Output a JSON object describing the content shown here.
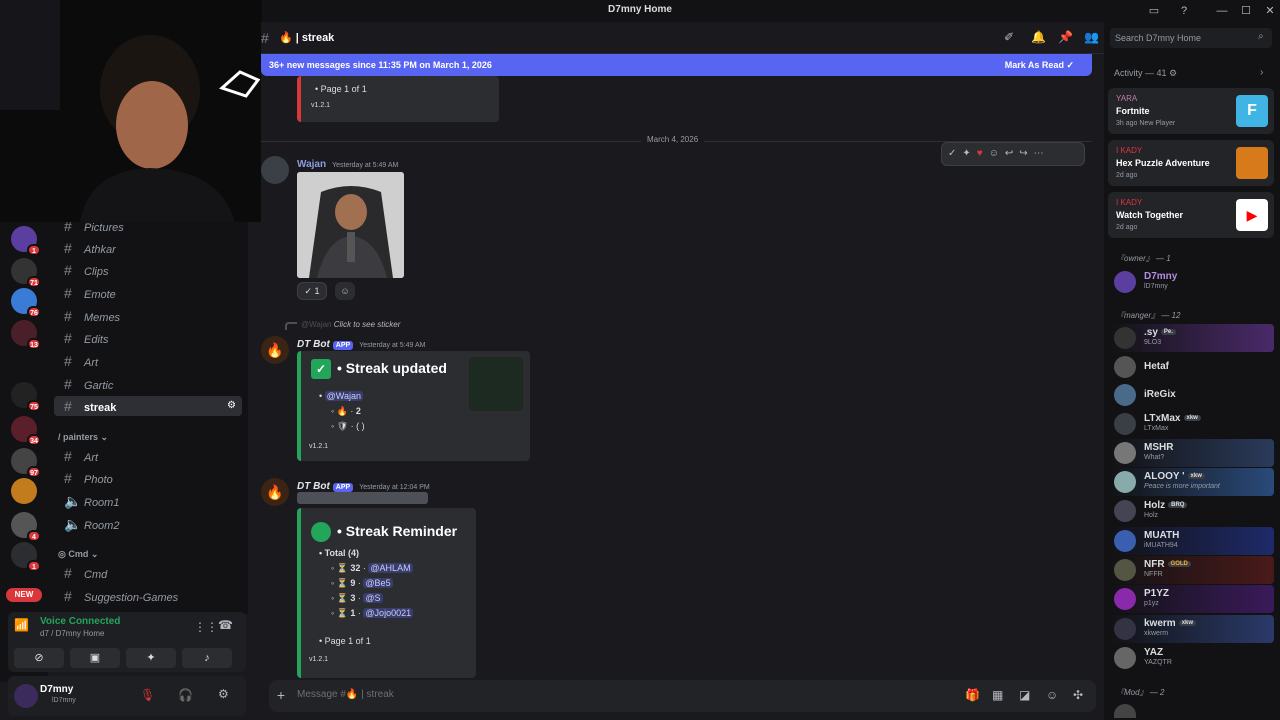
{
  "window": {
    "title": "D7mny Home"
  },
  "webcam_caption": "live streamer webcam",
  "servers": [
    {
      "badge": "1"
    },
    {
      "badge": "71"
    },
    {
      "badge": "76"
    },
    {
      "badge": "13"
    },
    {
      "badge": "75"
    },
    {
      "badge": "34"
    },
    {
      "badge": "97"
    },
    {
      "badge": ""
    },
    {
      "badge": "4"
    },
    {
      "badge": "1"
    }
  ],
  "new_badge": "NEW",
  "channels": {
    "items": [
      {
        "name": "Pictures"
      },
      {
        "name": "Athkar"
      },
      {
        "name": "Clips"
      },
      {
        "name": "Emote"
      },
      {
        "name": "Memes"
      },
      {
        "name": "Edits"
      },
      {
        "name": "Art"
      },
      {
        "name": "Gartic"
      },
      {
        "name": "streak"
      }
    ],
    "cat_painters": "painters",
    "painters_items": [
      {
        "name": "Art"
      },
      {
        "name": "Photo"
      },
      {
        "name": "Room1"
      },
      {
        "name": "Room2"
      }
    ],
    "cat_cmd": "Cmd",
    "cmd_items": [
      {
        "name": "Cmd"
      },
      {
        "name": "Suggestion-Games"
      }
    ]
  },
  "voice": {
    "status": "Voice Connected",
    "detail": "d7 / D7mny Home"
  },
  "user": {
    "name": "D7mny",
    "handle": "lD7mny"
  },
  "header": {
    "channel": "🔥 | streak",
    "search_placeholder": "Search D7mny Home"
  },
  "banner": {
    "text": "36+ new messages since 11:35 PM on March 1, 2026",
    "action": "Mark As Read"
  },
  "top_embed": {
    "page": "Page 1 of 1",
    "version": "v1.2.1"
  },
  "date_divider": "March 4, 2026",
  "msg1": {
    "author": "Wajan",
    "time": "Yesterday at 5:49 AM",
    "reaction_count": "1"
  },
  "reply": {
    "author": "@Wajan",
    "text": "Click to see sticker"
  },
  "msg2": {
    "author": "DT Bot",
    "app": "APP",
    "time": "Yesterday at 5:49 AM",
    "title": "Streak updated",
    "mention": "@Wajan",
    "line1": "2",
    "line2": "( )",
    "version": "v1.2.1"
  },
  "msg3": {
    "author": "DT Bot",
    "app": "APP",
    "time": "Yesterday at 12:04 PM",
    "title": "Streak Reminder",
    "total": "Total (4)",
    "rows": [
      {
        "n": "32",
        "u": "@AHLAM"
      },
      {
        "n": "9",
        "u": "@Be5"
      },
      {
        "n": "3",
        "u": "@S"
      },
      {
        "n": "1",
        "u": "@Jojo0021"
      }
    ],
    "page": "Page 1 of 1",
    "version": "v1.2.1"
  },
  "composer": {
    "placeholder": "Message #🔥 | streak"
  },
  "activity": {
    "header": "Activity — 41",
    "cards": [
      {
        "user": "YARA",
        "game": "Fortnite",
        "meta": "3h ago",
        "extra": "New Player"
      },
      {
        "user": "I KADY",
        "game": "Hex Puzzle Adventure",
        "meta": "2d ago",
        "extra": ""
      },
      {
        "user": "I KADY",
        "game": "Watch Together",
        "meta": "2d ago",
        "extra": ""
      }
    ]
  },
  "members": {
    "owner_header": "『owner』 — 1",
    "owner": [
      {
        "name": "D7mny",
        "status": "lD7mny"
      }
    ],
    "manger_header": "『manger』 — 12",
    "manger": [
      {
        "name": ".sy",
        "tag": "Pe.",
        "status": "9LO3"
      },
      {
        "name": "Hetaf",
        "tag": "",
        "status": ""
      },
      {
        "name": "iReGix",
        "tag": "",
        "status": ""
      },
      {
        "name": "LTxMax",
        "tag": "xkw",
        "status": "LTxMax"
      },
      {
        "name": "MSHR",
        "tag": "",
        "status": "What?"
      },
      {
        "name": "ALOOY '",
        "tag": "xkw",
        "status": "Peace is more important"
      },
      {
        "name": "Holz",
        "tag": "BRQ",
        "status": "Holz"
      },
      {
        "name": "MUATH",
        "tag": "",
        "status": "iMUATH94"
      },
      {
        "name": "NFR",
        "tag": "GOLD",
        "status": "NFFR"
      },
      {
        "name": "P1YZ",
        "tag": "",
        "status": "p1yz"
      },
      {
        "name": "kwerm",
        "tag": "xkw",
        "status": "xkwerm"
      },
      {
        "name": "YAZ",
        "tag": "",
        "status": "YAZQTR"
      }
    ],
    "mod_header": "『Mod』 — 2"
  },
  "colors": {
    "accent": "#5865f2",
    "green": "#23a55a",
    "red": "#da373c"
  }
}
